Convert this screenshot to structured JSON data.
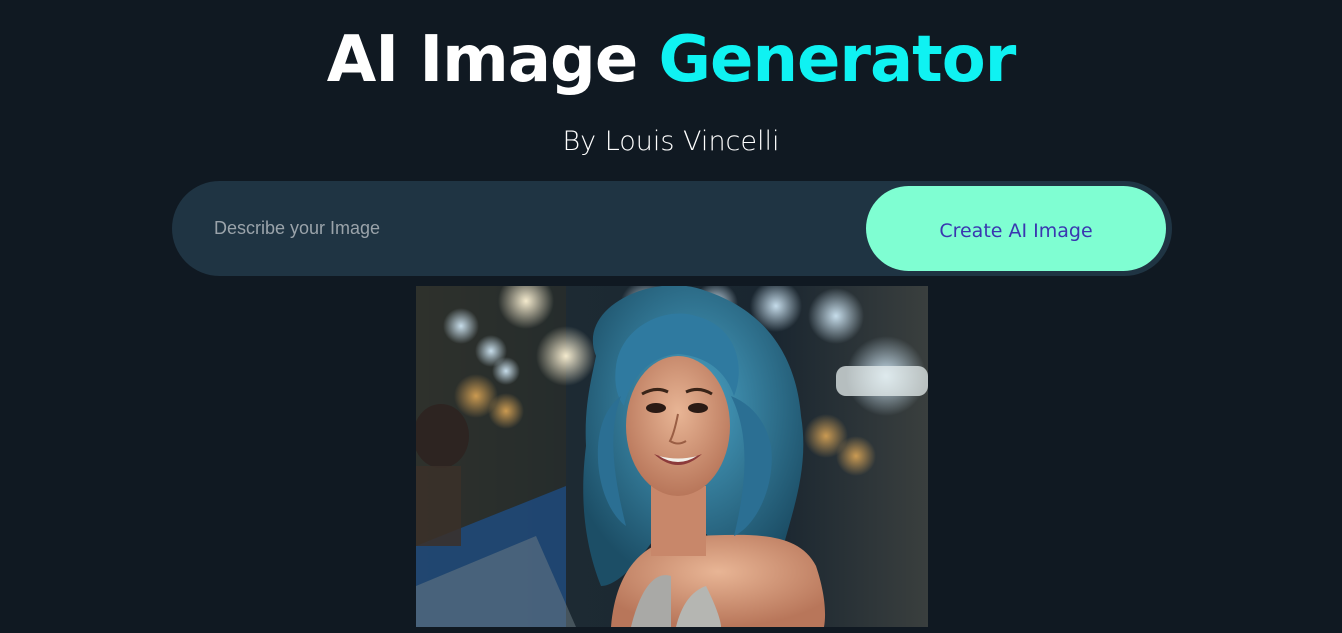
{
  "header": {
    "title_main": "AI Image ",
    "title_accent": "Generator",
    "subtitle": "By Louis Vincelli"
  },
  "prompt": {
    "placeholder": "Describe your Image",
    "value": ""
  },
  "actions": {
    "create_label": "Create AI Image"
  },
  "colors": {
    "background": "#101922",
    "accent": "#0ff2f2",
    "button_bg": "#7ffed2",
    "button_text": "#3a36b0",
    "bar_bg": "#1f3443"
  },
  "result": {
    "image_semantic": "ai-generated-portrait-blue-curly-hair-woman"
  }
}
